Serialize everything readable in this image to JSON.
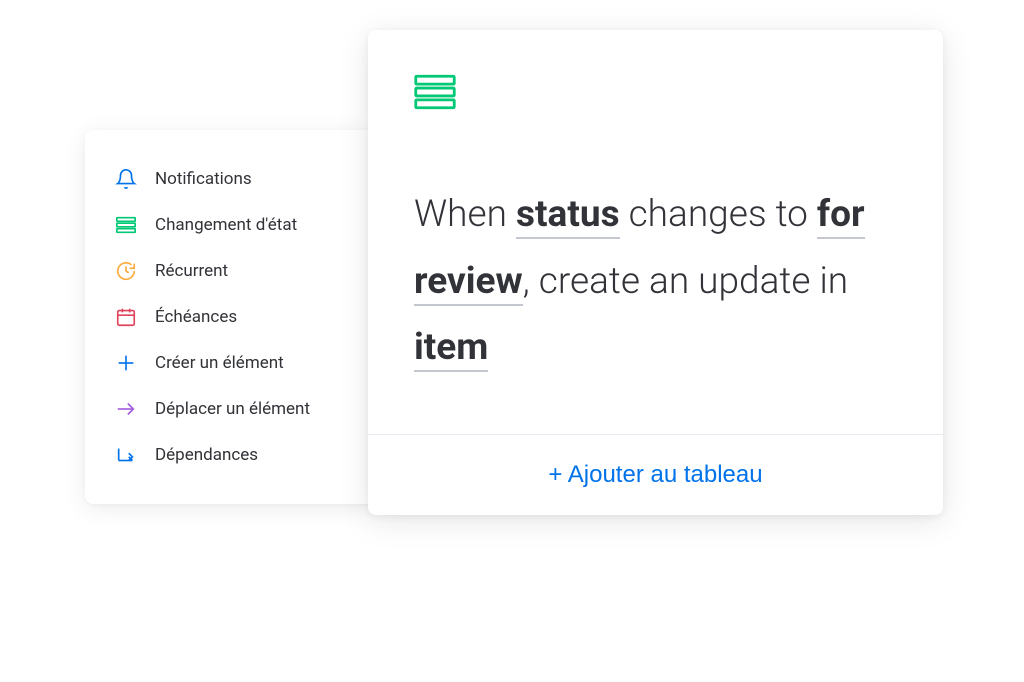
{
  "colors": {
    "blue": "#0073ea",
    "green": "#00c875",
    "orange": "#fdab3d",
    "red": "#e2445c",
    "purple": "#a25ddc",
    "darkblue": "#579bfc",
    "text": "#323338"
  },
  "menu": {
    "items": [
      {
        "key": "notifications",
        "label": "Notifications",
        "icon": "bell",
        "color": "#0073ea"
      },
      {
        "key": "status-change",
        "label": "Changement d'état",
        "icon": "status-bars",
        "color": "#00c875"
      },
      {
        "key": "recurrent",
        "label": "Récurrent",
        "icon": "clock",
        "color": "#fdab3d"
      },
      {
        "key": "deadlines",
        "label": "Échéances",
        "icon": "calendar",
        "color": "#e2445c"
      },
      {
        "key": "create-item",
        "label": "Créer un élément",
        "icon": "plus",
        "color": "#0073ea"
      },
      {
        "key": "move-item",
        "label": "Déplacer un élément",
        "icon": "arrow-right",
        "color": "#a25ddc"
      },
      {
        "key": "dependencies",
        "label": "Dépendances",
        "icon": "dependency",
        "color": "#0073ea"
      }
    ]
  },
  "card": {
    "sentence": {
      "part1": "When ",
      "token1": "status",
      "part2": " changes to ",
      "token2": "for review",
      "part3": ", create an update in ",
      "token3": "item"
    },
    "add_button": "+ Ajouter au tableau"
  }
}
